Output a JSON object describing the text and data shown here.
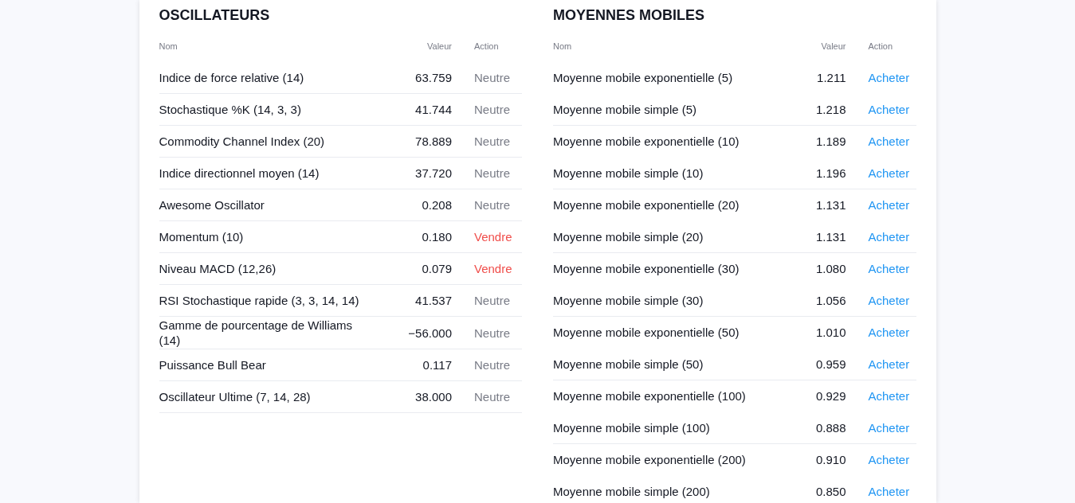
{
  "oscillators": {
    "title": "OSCILLATEURS",
    "columns": [
      "Nom",
      "Valeur",
      "Action"
    ],
    "rows": [
      {
        "name": "Indice de force relative (14)",
        "value": "63.759",
        "action": "Neutre",
        "color": "#787b86"
      },
      {
        "name": "Stochastique %K (14, 3, 3)",
        "value": "41.744",
        "action": "Neutre",
        "color": "#787b86"
      },
      {
        "name": "Commodity Channel Index (20)",
        "value": "78.889",
        "action": "Neutre",
        "color": "#787b86"
      },
      {
        "name": "Indice directionnel moyen (14)",
        "value": "37.720",
        "action": "Neutre",
        "color": "#787b86"
      },
      {
        "name": "Awesome Oscillator",
        "value": "0.208",
        "action": "Neutre",
        "color": "#787b86"
      },
      {
        "name": "Momentum (10)",
        "value": "0.180",
        "action": "Vendre",
        "color": "#f04e4b"
      },
      {
        "name": "Niveau MACD (12,26)",
        "value": "0.079",
        "action": "Vendre",
        "color": "#f04e4b"
      },
      {
        "name": "RSI Stochastique rapide (3, 3, 14, 14)",
        "value": "41.537",
        "action": "Neutre",
        "color": "#787b86"
      },
      {
        "name": "Gamme de pourcentage de Williams (14)",
        "value": "−56.000",
        "action": "Neutre",
        "color": "#787b86"
      },
      {
        "name": "Puissance Bull Bear",
        "value": "0.117",
        "action": "Neutre",
        "color": "#787b86"
      },
      {
        "name": "Oscillateur Ultime (7, 14, 28)",
        "value": "38.000",
        "action": "Neutre",
        "color": "#787b86"
      }
    ]
  },
  "moving_averages": {
    "title": "MOYENNES MOBILES",
    "columns": [
      "Nom",
      "Valeur",
      "Action"
    ],
    "groups": [
      {
        "rows": [
          {
            "name": "Moyenne mobile exponentielle (5)",
            "value": "1.211",
            "action": "Acheter",
            "color": "#2196f3"
          },
          {
            "name": "Moyenne mobile simple (5)",
            "value": "1.218",
            "action": "Acheter",
            "color": "#2196f3"
          }
        ]
      },
      {
        "rows": [
          {
            "name": "Moyenne mobile exponentielle (10)",
            "value": "1.189",
            "action": "Acheter",
            "color": "#2196f3"
          },
          {
            "name": "Moyenne mobile simple (10)",
            "value": "1.196",
            "action": "Acheter",
            "color": "#2196f3"
          }
        ]
      },
      {
        "rows": [
          {
            "name": "Moyenne mobile exponentielle (20)",
            "value": "1.131",
            "action": "Acheter",
            "color": "#2196f3"
          },
          {
            "name": "Moyenne mobile simple (20)",
            "value": "1.131",
            "action": "Acheter",
            "color": "#2196f3"
          }
        ]
      },
      {
        "rows": [
          {
            "name": "Moyenne mobile exponentielle (30)",
            "value": "1.080",
            "action": "Acheter",
            "color": "#2196f3"
          },
          {
            "name": "Moyenne mobile simple (30)",
            "value": "1.056",
            "action": "Acheter",
            "color": "#2196f3"
          }
        ]
      },
      {
        "rows": [
          {
            "name": "Moyenne mobile exponentielle (50)",
            "value": "1.010",
            "action": "Acheter",
            "color": "#2196f3"
          },
          {
            "name": "Moyenne mobile simple (50)",
            "value": "0.959",
            "action": "Acheter",
            "color": "#2196f3"
          }
        ]
      },
      {
        "rows": [
          {
            "name": "Moyenne mobile exponentielle (100)",
            "value": "0.929",
            "action": "Acheter",
            "color": "#2196f3"
          },
          {
            "name": "Moyenne mobile simple (100)",
            "value": "0.888",
            "action": "Acheter",
            "color": "#2196f3"
          }
        ]
      },
      {
        "rows": [
          {
            "name": "Moyenne mobile exponentielle (200)",
            "value": "0.910",
            "action": "Acheter",
            "color": "#2196f3"
          },
          {
            "name": "Moyenne mobile simple (200)",
            "value": "0.850",
            "action": "Acheter",
            "color": "#2196f3"
          }
        ]
      }
    ]
  }
}
